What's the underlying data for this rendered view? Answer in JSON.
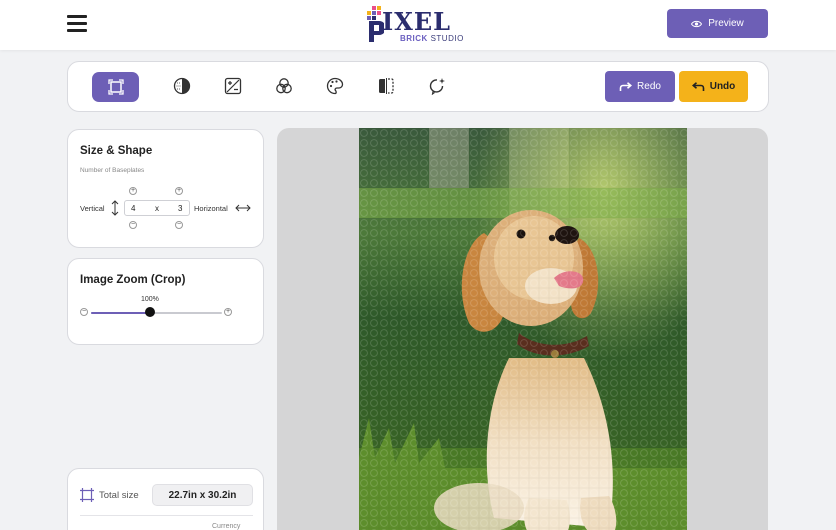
{
  "header": {
    "logo_word": "IXEL",
    "logo_sub_1": "BRICK",
    "logo_sub_2": "STUDIO",
    "preview_label": "Preview"
  },
  "toolbar": {
    "tools": [
      "crop-icon",
      "contrast-icon",
      "exposure-icon",
      "color-channels-icon",
      "palette-icon",
      "mirror-icon",
      "rotate-magic-icon"
    ],
    "redo_label": "Redo",
    "undo_label": "Undo"
  },
  "size_shape": {
    "title": "Size & Shape",
    "subtitle": "Number of Baseplates",
    "vertical_label": "Vertical",
    "horizontal_label": "Horizontal",
    "vertical_value": "4",
    "separator": "x",
    "horizontal_value": "3"
  },
  "image_zoom": {
    "title": "Image Zoom (Crop)",
    "value_label": "100%",
    "slider_fraction": 0.45
  },
  "total": {
    "label": "Total size",
    "value": "22.7in x 30.2in",
    "currency_label": "Currency"
  },
  "colors": {
    "accent": "#6d5fb6",
    "undo": "#f4b21a",
    "brand_dark": "#2b2d6e"
  }
}
